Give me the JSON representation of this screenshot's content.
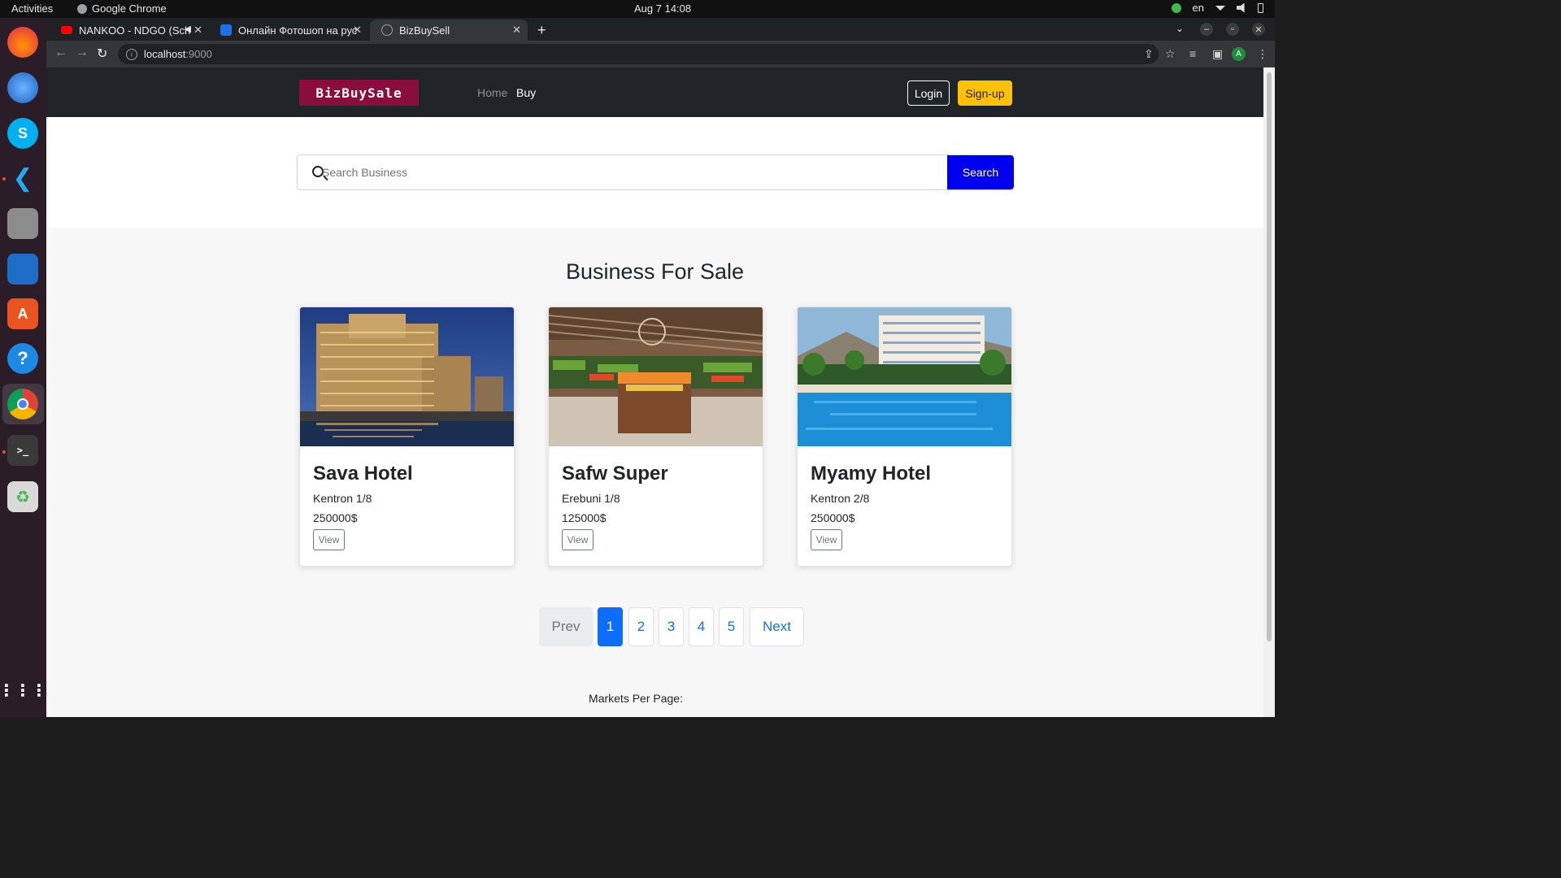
{
  "system": {
    "activities": "Activities",
    "app_name": "Google Chrome",
    "clock": "Aug 7  14:08",
    "lang": "en"
  },
  "browser": {
    "tabs": [
      {
        "title": "NANKOO - NDGO (Sch",
        "favicon_color": "#ff0000"
      },
      {
        "title": "Онлайн Фотошоп на рус",
        "favicon_color": "#1a73e8"
      },
      {
        "title": "BizBuySell",
        "favicon_color": "#9aa0a6"
      }
    ],
    "url_host": "localhost",
    "url_port": ":9000"
  },
  "site": {
    "brand": "BizBuySale",
    "nav": {
      "home": "Home",
      "buy": "Buy"
    },
    "login": "Login",
    "signup": "Sign-up",
    "search": {
      "placeholder": "Search Business",
      "button": "Search"
    },
    "section_title": "Business For Sale",
    "listings": [
      {
        "name": "Sava Hotel",
        "location": "Kentron 1/8",
        "price": "250000$",
        "action": "View",
        "image": "hotel-night-photo"
      },
      {
        "name": "Safw Super",
        "location": "Erebuni 1/8",
        "price": "125000$",
        "action": "View",
        "image": "supermarket-photo"
      },
      {
        "name": "Myamy Hotel",
        "location": "Kentron 2/8",
        "price": "250000$",
        "action": "View",
        "image": "resort-pool-photo"
      }
    ],
    "pagination": {
      "prev": "Prev",
      "pages": [
        "1",
        "2",
        "3",
        "4",
        "5"
      ],
      "current": "1",
      "next": "Next"
    },
    "per_page_label": "Markets Per Page:"
  },
  "colors": {
    "brand_bg": "#8a0e3b",
    "header_bg": "#212529",
    "signup_bg": "#ffc107",
    "search_btn": "#0000ee",
    "page_active": "#0d6efd"
  }
}
